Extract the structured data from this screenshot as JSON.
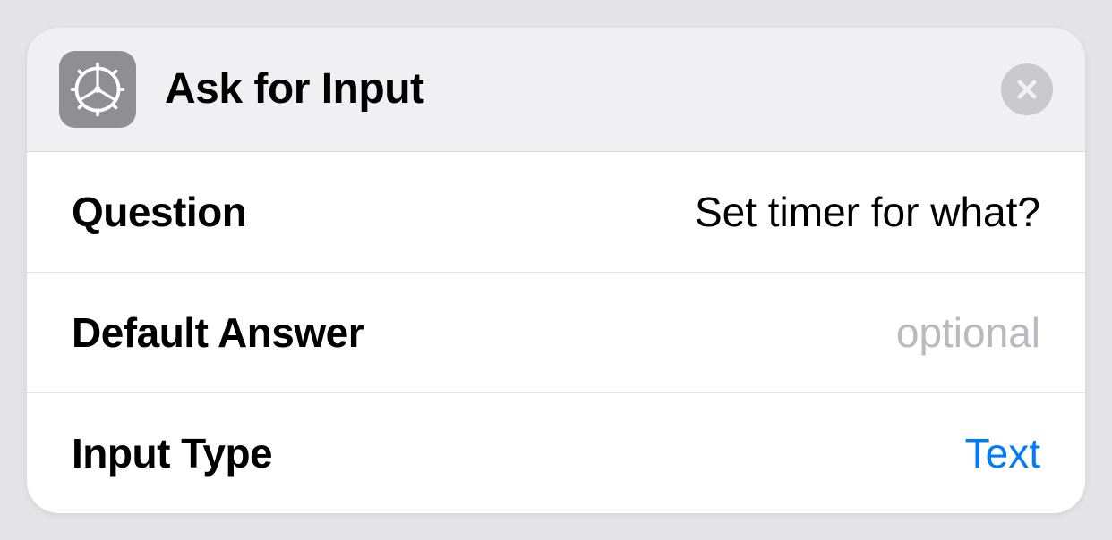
{
  "header": {
    "title": "Ask for Input"
  },
  "rows": {
    "question": {
      "label": "Question",
      "value": "Set timer for what?"
    },
    "defaultAnswer": {
      "label": "Default Answer",
      "placeholder": "optional",
      "value": ""
    },
    "inputType": {
      "label": "Input Type",
      "value": "Text"
    }
  }
}
